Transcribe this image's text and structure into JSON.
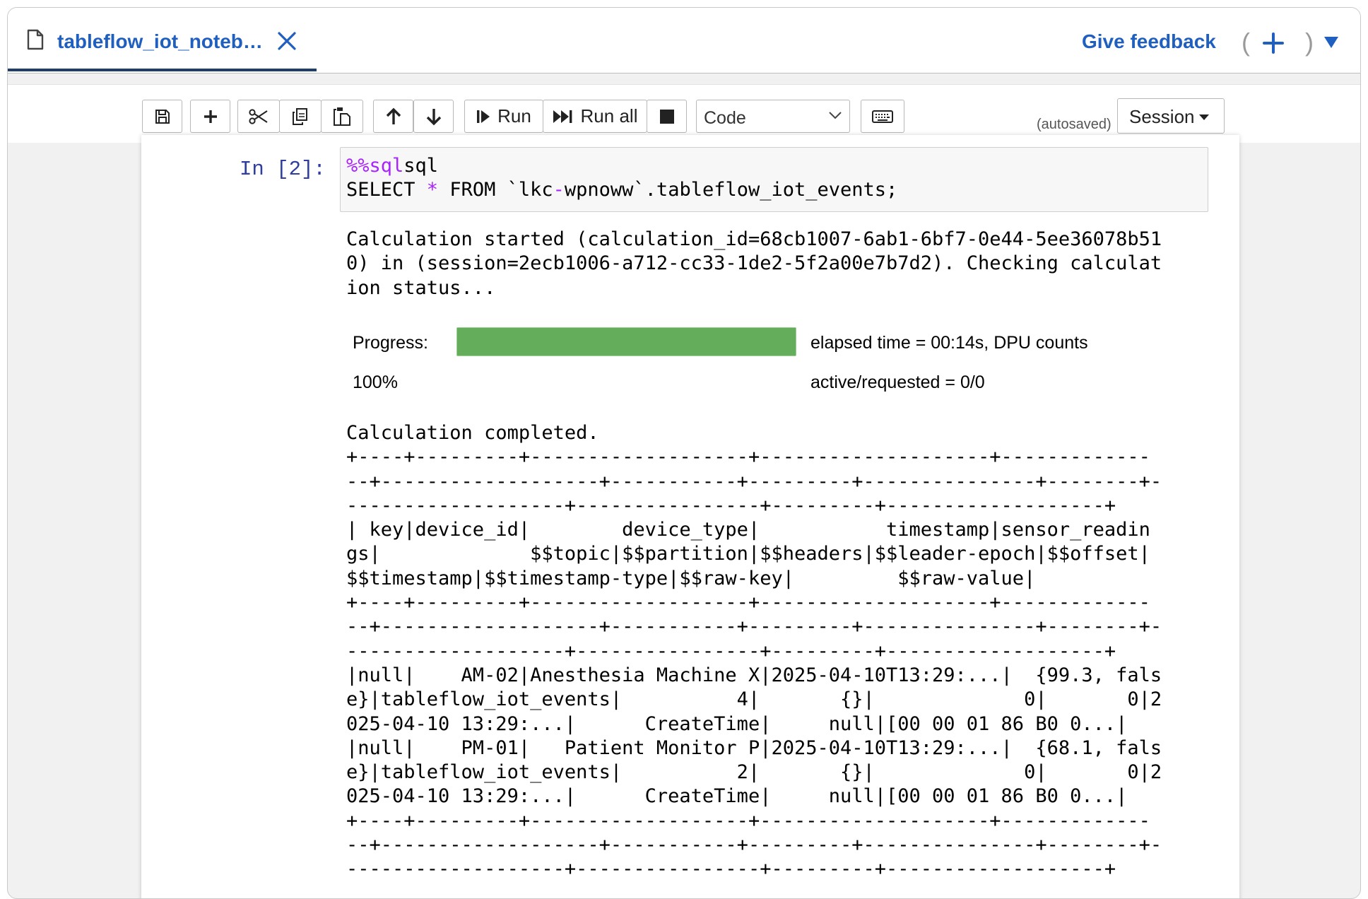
{
  "tab": {
    "title": "tableflow_iot_noteb…",
    "icons": {
      "file": "file-icon",
      "close": "close-icon"
    }
  },
  "header": {
    "feedback_label": "Give feedback",
    "paren_open": "(",
    "paren_close": ")",
    "icons": {
      "add": "plus-icon",
      "menu": "triangle-down-icon"
    }
  },
  "toolbar": {
    "save_icon": "save-icon",
    "insert_icon": "plus-icon",
    "cut_icon": "scissors-icon",
    "copy_icon": "copy-icon",
    "paste_icon": "paste-icon",
    "move_up_icon": "arrow-up-icon",
    "move_down_icon": "arrow-down-icon",
    "run_label": "Run",
    "run_all_label": "Run all",
    "stop_icon": "stop-icon",
    "cell_type_selected": "Code",
    "keyboard_icon": "keyboard-icon",
    "autosaved_label": "(autosaved)",
    "session_label": "Session"
  },
  "cell": {
    "prompt": "In [2]:",
    "code_magic": "%%sql",
    "code_select": "SELECT ",
    "code_star": "*",
    "code_from": " FROM `lkc",
    "code_dash": "-",
    "code_rest": "wpnoww`.tableflow_iot_events;"
  },
  "output": {
    "start_text": "Calculation started (calculation_id=68cb1007-6ab1-6bf7-0e44-5ee36078b51\n0) in (session=2ecb1006-a712-cc33-1de2-5f2a00e7b7d2). Checking calculat\nion status...",
    "progress_label": "Progress:",
    "progress_percent_text": "100%",
    "progress_fraction": 1.0,
    "progress_color": "#63ad5b",
    "elapsed_line1": "elapsed time = 00:14s, DPU counts",
    "elapsed_line2": "active/requested = 0/0",
    "result_text": "Calculation completed.\n+----+---------+-------------------+--------------------+-------------\n--+-------------------+-----------+---------+---------------+--------+-\n-------------------+----------------+---------+-------------------+\n| key|device_id|        device_type|           timestamp|sensor_readin\ngs|             $$topic|$$partition|$$headers|$$leader-epoch|$$offset|\n$$timestamp|$$timestamp-type|$$raw-key|         $$raw-value|\n+----+---------+-------------------+--------------------+-------------\n--+-------------------+-----------+---------+---------------+--------+-\n-------------------+----------------+---------+-------------------+\n|null|    AM-02|Anesthesia Machine X|2025-04-10T13:29:...|  {99.3, fals\ne}|tableflow_iot_events|          4|       {}|             0|       0|2\n025-04-10 13:29:...|      CreateTime|     null|[00 00 01 86 B0 0...|\n|null|    PM-01|   Patient Monitor P|2025-04-10T13:29:...|  {68.1, fals\ne}|tableflow_iot_events|          2|       {}|             0|       0|2\n025-04-10 13:29:...|      CreateTime|     null|[00 00 01 86 B0 0...|\n+----+---------+-------------------+--------------------+-------------\n--+-------------------+-----------+---------+---------------+--------+-\n-------------------+----------------+---------+-------------------+"
  }
}
